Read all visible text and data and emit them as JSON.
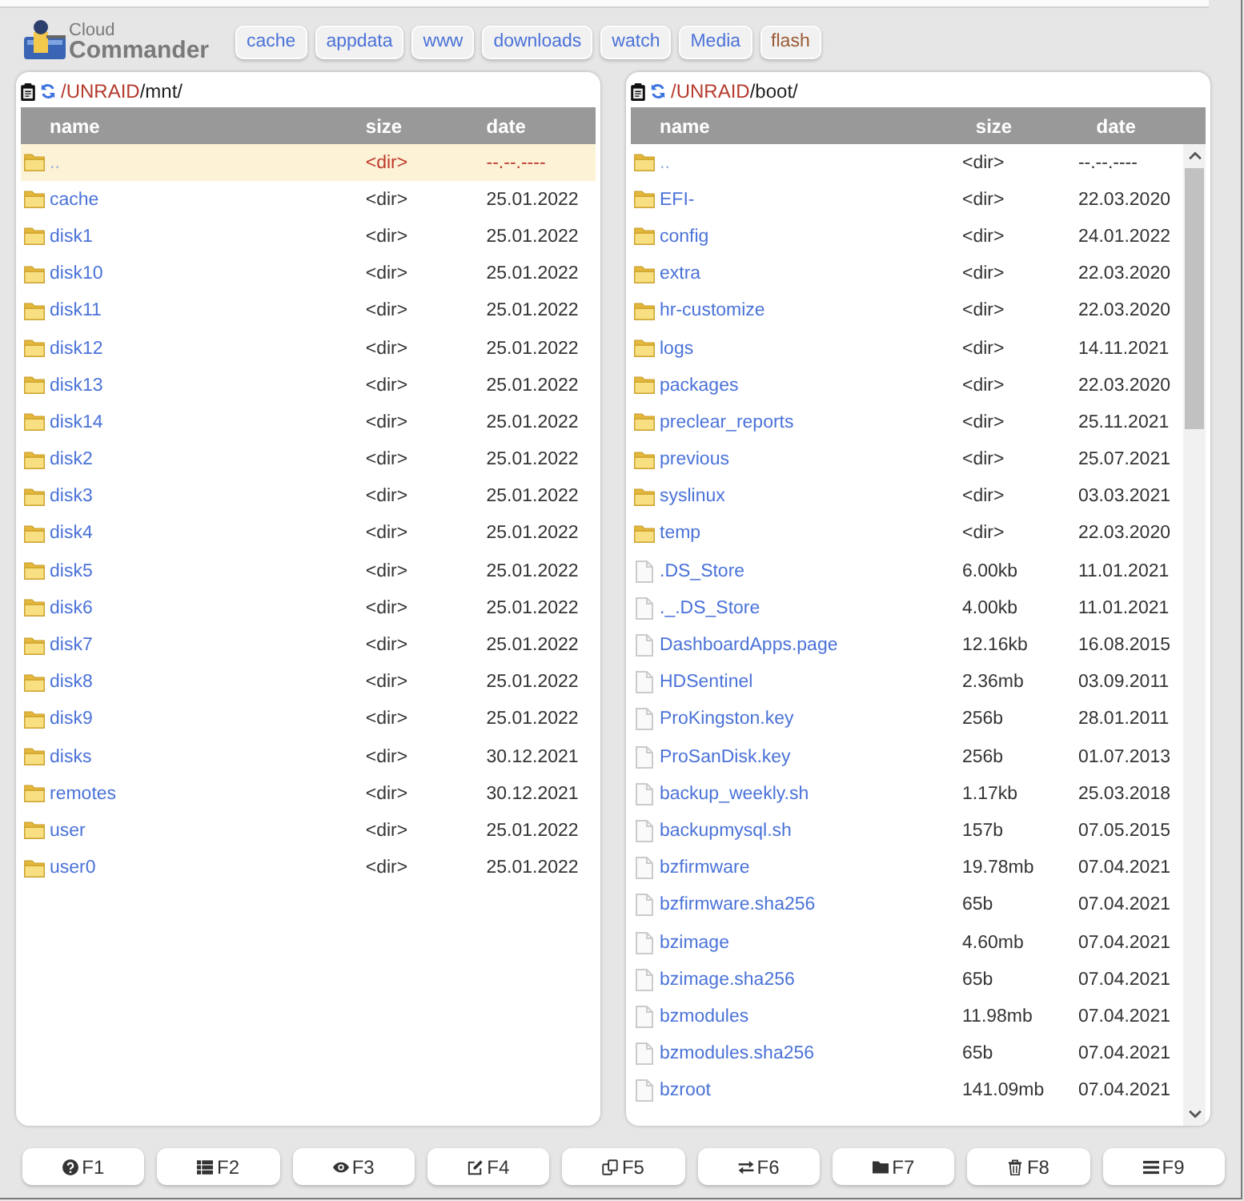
{
  "header": {
    "logo": {
      "line_1": "Cloud",
      "line_2": "Commander"
    },
    "bookmarks": [
      {
        "label": "cache",
        "selected": false
      },
      {
        "label": "appdata",
        "selected": false
      },
      {
        "label": "www",
        "selected": false
      },
      {
        "label": "downloads",
        "selected": false
      },
      {
        "label": "watch",
        "selected": false
      },
      {
        "label": "Media",
        "selected": false
      },
      {
        "label": "flash",
        "selected": true
      }
    ]
  },
  "panels": [
    {
      "path": [
        {
          "text": "/UNRAID",
          "kind": "link"
        },
        {
          "text": "/mnt/",
          "kind": "current"
        }
      ],
      "columns": [
        "name",
        "size",
        "date"
      ],
      "scrollbar": false,
      "rows": [
        {
          "kind": "parent",
          "name": "..",
          "size": "<dir>",
          "date": "--.--.----",
          "selected": true
        },
        {
          "kind": "dir",
          "name": "cache",
          "size": "<dir>",
          "date": "25.01.2022",
          "selected": false
        },
        {
          "kind": "dir",
          "name": "disk1",
          "size": "<dir>",
          "date": "25.01.2022",
          "selected": false
        },
        {
          "kind": "dir",
          "name": "disk10",
          "size": "<dir>",
          "date": "25.01.2022",
          "selected": false
        },
        {
          "kind": "dir",
          "name": "disk11",
          "size": "<dir>",
          "date": "25.01.2022",
          "selected": false
        },
        {
          "kind": "dir",
          "name": "disk12",
          "size": "<dir>",
          "date": "25.01.2022",
          "selected": false
        },
        {
          "kind": "dir",
          "name": "disk13",
          "size": "<dir>",
          "date": "25.01.2022",
          "selected": false
        },
        {
          "kind": "dir",
          "name": "disk14",
          "size": "<dir>",
          "date": "25.01.2022",
          "selected": false
        },
        {
          "kind": "dir",
          "name": "disk2",
          "size": "<dir>",
          "date": "25.01.2022",
          "selected": false
        },
        {
          "kind": "dir",
          "name": "disk3",
          "size": "<dir>",
          "date": "25.01.2022",
          "selected": false
        },
        {
          "kind": "dir",
          "name": "disk4",
          "size": "<dir>",
          "date": "25.01.2022",
          "selected": false
        },
        {
          "kind": "dir",
          "name": "disk5",
          "size": "<dir>",
          "date": "25.01.2022",
          "selected": false
        },
        {
          "kind": "dir",
          "name": "disk6",
          "size": "<dir>",
          "date": "25.01.2022",
          "selected": false
        },
        {
          "kind": "dir",
          "name": "disk7",
          "size": "<dir>",
          "date": "25.01.2022",
          "selected": false
        },
        {
          "kind": "dir",
          "name": "disk8",
          "size": "<dir>",
          "date": "25.01.2022",
          "selected": false
        },
        {
          "kind": "dir",
          "name": "disk9",
          "size": "<dir>",
          "date": "25.01.2022",
          "selected": false
        },
        {
          "kind": "dir",
          "name": "disks",
          "size": "<dir>",
          "date": "30.12.2021",
          "selected": false
        },
        {
          "kind": "dir",
          "name": "remotes",
          "size": "<dir>",
          "date": "30.12.2021",
          "selected": false
        },
        {
          "kind": "dir",
          "name": "user",
          "size": "<dir>",
          "date": "25.01.2022",
          "selected": false
        },
        {
          "kind": "dir",
          "name": "user0",
          "size": "<dir>",
          "date": "25.01.2022",
          "selected": false
        }
      ]
    },
    {
      "path": [
        {
          "text": "/UNRAID",
          "kind": "link"
        },
        {
          "text": "/boot/",
          "kind": "current"
        }
      ],
      "columns": [
        "name",
        "size",
        "date"
      ],
      "scrollbar": true,
      "rows": [
        {
          "kind": "parent",
          "name": "..",
          "size": "<dir>",
          "date": "--.--.----",
          "selected": false
        },
        {
          "kind": "dir",
          "name": "EFI-",
          "size": "<dir>",
          "date": "22.03.2020",
          "selected": false
        },
        {
          "kind": "dir",
          "name": "config",
          "size": "<dir>",
          "date": "24.01.2022",
          "selected": false
        },
        {
          "kind": "dir",
          "name": "extra",
          "size": "<dir>",
          "date": "22.03.2020",
          "selected": false
        },
        {
          "kind": "dir",
          "name": "hr-customize",
          "size": "<dir>",
          "date": "22.03.2020",
          "selected": false
        },
        {
          "kind": "dir",
          "name": "logs",
          "size": "<dir>",
          "date": "14.11.2021",
          "selected": false
        },
        {
          "kind": "dir",
          "name": "packages",
          "size": "<dir>",
          "date": "22.03.2020",
          "selected": false
        },
        {
          "kind": "dir",
          "name": "preclear_reports",
          "size": "<dir>",
          "date": "25.11.2021",
          "selected": false
        },
        {
          "kind": "dir",
          "name": "previous",
          "size": "<dir>",
          "date": "25.07.2021",
          "selected": false
        },
        {
          "kind": "dir",
          "name": "syslinux",
          "size": "<dir>",
          "date": "03.03.2021",
          "selected": false
        },
        {
          "kind": "dir",
          "name": "temp",
          "size": "<dir>",
          "date": "22.03.2020",
          "selected": false
        },
        {
          "kind": "file",
          "name": ".DS_Store",
          "size": "6.00kb",
          "date": "11.01.2021",
          "selected": false
        },
        {
          "kind": "file",
          "name": "._.DS_Store",
          "size": "4.00kb",
          "date": "11.01.2021",
          "selected": false
        },
        {
          "kind": "file",
          "name": "DashboardApps.page",
          "size": "12.16kb",
          "date": "16.08.2015",
          "selected": false
        },
        {
          "kind": "file",
          "name": "HDSentinel",
          "size": "2.36mb",
          "date": "03.09.2011",
          "selected": false
        },
        {
          "kind": "file",
          "name": "ProKingston.key",
          "size": "256b",
          "date": "28.01.2011",
          "selected": false
        },
        {
          "kind": "file",
          "name": "ProSanDisk.key",
          "size": "256b",
          "date": "01.07.2013",
          "selected": false
        },
        {
          "kind": "file",
          "name": "backup_weekly.sh",
          "size": "1.17kb",
          "date": "25.03.2018",
          "selected": false
        },
        {
          "kind": "file",
          "name": "backupmysql.sh",
          "size": "157b",
          "date": "07.05.2015",
          "selected": false
        },
        {
          "kind": "file",
          "name": "bzfirmware",
          "size": "19.78mb",
          "date": "07.04.2021",
          "selected": false
        },
        {
          "kind": "file",
          "name": "bzfirmware.sha256",
          "size": "65b",
          "date": "07.04.2021",
          "selected": false
        },
        {
          "kind": "file",
          "name": "bzimage",
          "size": "4.60mb",
          "date": "07.04.2021",
          "selected": false
        },
        {
          "kind": "file",
          "name": "bzimage.sha256",
          "size": "65b",
          "date": "07.04.2021",
          "selected": false
        },
        {
          "kind": "file",
          "name": "bzmodules",
          "size": "11.98mb",
          "date": "07.04.2021",
          "selected": false
        },
        {
          "kind": "file",
          "name": "bzmodules.sha256",
          "size": "65b",
          "date": "07.04.2021",
          "selected": false
        },
        {
          "kind": "file",
          "name": "bzroot",
          "size": "141.09mb",
          "date": "07.04.2021",
          "selected": false
        }
      ]
    }
  ],
  "function_keys": [
    {
      "label": "F1"
    },
    {
      "label": "F2"
    },
    {
      "label": "F3"
    },
    {
      "label": "F4"
    },
    {
      "label": "F5"
    },
    {
      "label": "F6"
    },
    {
      "label": "F7"
    },
    {
      "label": "F8"
    },
    {
      "label": "F9"
    }
  ]
}
